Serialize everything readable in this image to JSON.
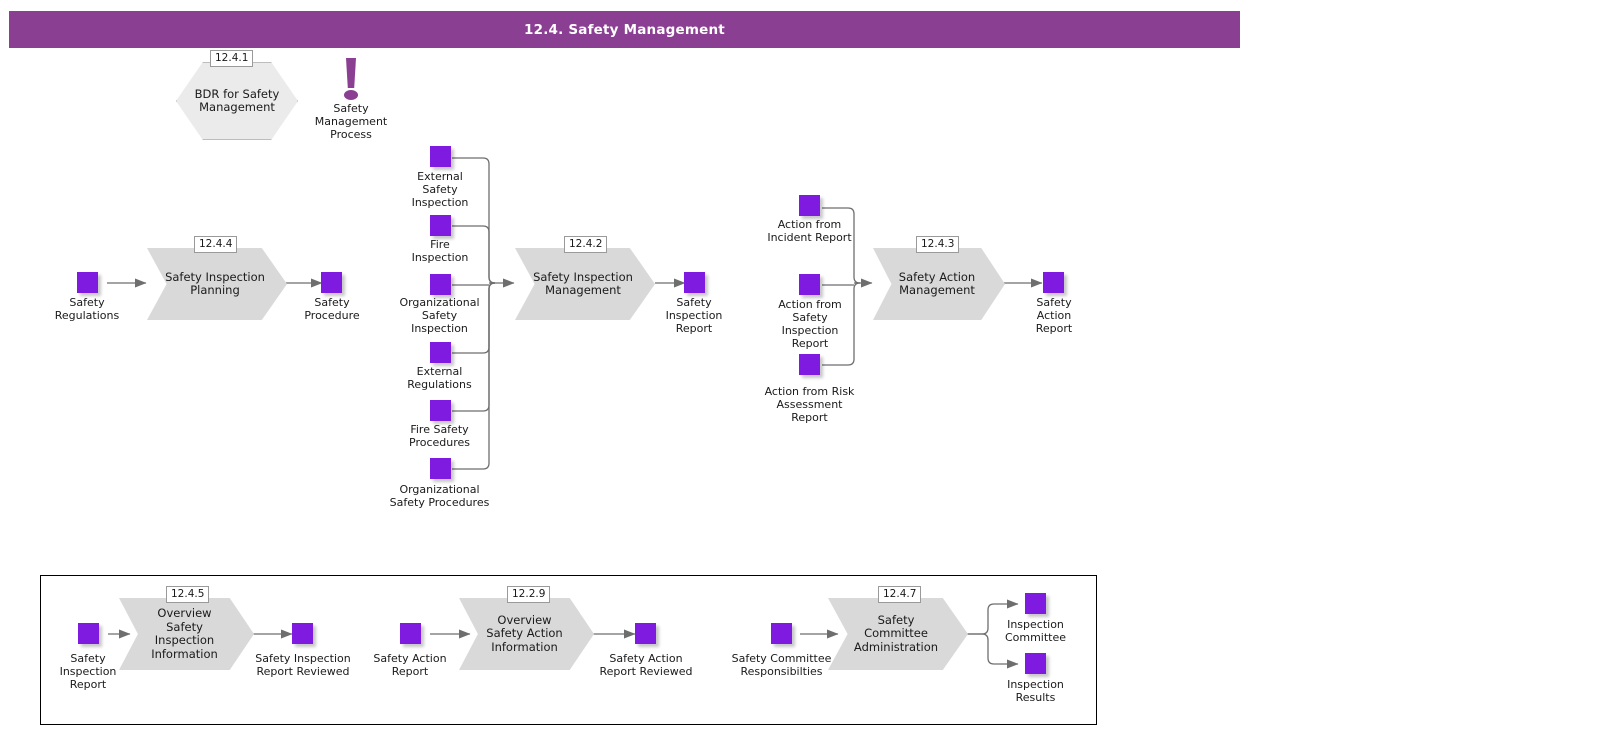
{
  "header": {
    "title": "12.4. Safety Management",
    "bar_color": "#8b3f92"
  },
  "colors": {
    "data_square": "#7f1ae1",
    "process_fill": "#d9d9d9",
    "hexagon_fill": "#ebebeb",
    "connector": "#6e6e6e",
    "frame_border": "#000000"
  },
  "top_area": {
    "bdr": {
      "badge": "12.4.1",
      "label": "BDR for Safety\nManagement"
    },
    "process_marker": {
      "icon": "exclamation-icon",
      "label": "Safety\nManagement\nProcess"
    }
  },
  "flow_planning": {
    "badge": "12.4.4",
    "process_label": "Safety Inspection\nPlanning",
    "input": {
      "label": "Safety\nRegulations"
    },
    "output": {
      "label": "Safety\nProcedure"
    }
  },
  "flow_inspection_mgmt": {
    "badge": "12.4.2",
    "process_label": "Safety Inspection\nManagement",
    "inputs": [
      {
        "label": "External\nSafety\nInspection"
      },
      {
        "label": "Fire\nInspection"
      },
      {
        "label": "Organizational\nSafety\nInspection"
      },
      {
        "label": "External\nRegulations"
      },
      {
        "label": "Fire Safety\nProcedures"
      },
      {
        "label": "Organizational\nSafety Procedures"
      }
    ],
    "output": {
      "label": "Safety\nInspection\nReport"
    }
  },
  "flow_action_mgmt": {
    "badge": "12.4.3",
    "process_label": "Safety Action\nManagement",
    "inputs": [
      {
        "label": "Action from\nIncident Report"
      },
      {
        "label": "Action from\nSafety\nInspection\nReport"
      },
      {
        "label": "Action from Risk\nAssessment\nReport"
      }
    ],
    "output": {
      "label": "Safety\nAction\nReport"
    }
  },
  "bottom_group": {
    "flows": [
      {
        "badge": "12.4.5",
        "process_label": "Overview\nSafety\nInspection\nInformation",
        "input": {
          "label": "Safety\nInspection\nReport"
        },
        "outputs": [
          {
            "label": "Safety Inspection\nReport Reviewed"
          }
        ]
      },
      {
        "badge": "12.2.9",
        "process_label": "Overview\nSafety Action\nInformation",
        "input": {
          "label": "Safety Action\nReport"
        },
        "outputs": [
          {
            "label": "Safety Action\nReport Reviewed"
          }
        ]
      },
      {
        "badge": "12.4.7",
        "process_label": "Safety\nCommittee\nAdministration",
        "input": {
          "label": "Safety Committee\nResponsibilties"
        },
        "outputs": [
          {
            "label": "Inspection\nCommittee"
          },
          {
            "label": "Inspection\nResults"
          }
        ]
      }
    ]
  }
}
